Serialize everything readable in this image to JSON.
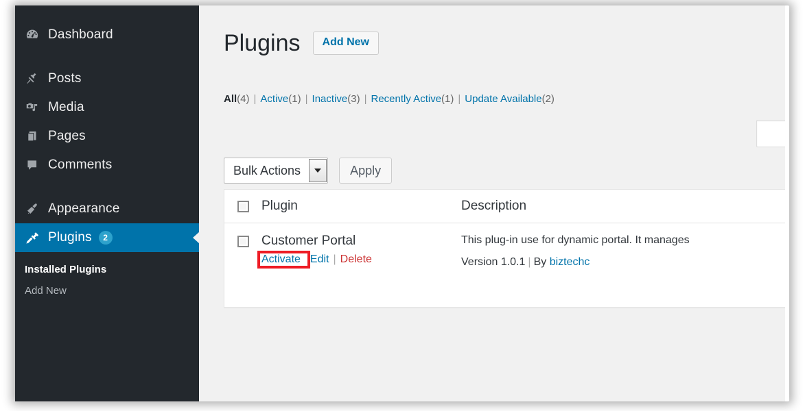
{
  "sidebar": {
    "items": [
      {
        "label": "Dashboard",
        "icon": "dashboard-gauge-icon",
        "name": "dashboard"
      },
      {
        "label": "Posts",
        "icon": "pushpin-icon",
        "name": "posts"
      },
      {
        "label": "Media",
        "icon": "media-camera-music-icon",
        "name": "media"
      },
      {
        "label": "Pages",
        "icon": "pages-stack-icon",
        "name": "pages"
      },
      {
        "label": "Comments",
        "icon": "comment-bubble-icon",
        "name": "comments"
      },
      {
        "label": "Appearance",
        "icon": "paintbrush-icon",
        "name": "appearance"
      },
      {
        "label": "Plugins",
        "icon": "plug-icon",
        "name": "plugins",
        "badge": "2",
        "current": true
      }
    ],
    "submenu": [
      {
        "label": "Installed Plugins",
        "current": true
      },
      {
        "label": "Add New",
        "current": false
      }
    ]
  },
  "header": {
    "title": "Plugins",
    "add_new_label": "Add New"
  },
  "filters": {
    "items": [
      {
        "label": "All",
        "count": "(4)",
        "current": true
      },
      {
        "label": "Active",
        "count": "(1)",
        "current": false
      },
      {
        "label": "Inactive",
        "count": "(3)",
        "current": false
      },
      {
        "label": "Recently Active",
        "count": "(1)",
        "current": false
      },
      {
        "label": "Update Available",
        "count": "(2)",
        "current": false
      }
    ],
    "separator": "|"
  },
  "search": {
    "value": "",
    "placeholder": ""
  },
  "tablenav": {
    "bulk_actions_label": "Bulk Actions",
    "apply_label": "Apply"
  },
  "table": {
    "headers": {
      "plugin": "Plugin",
      "description": "Description"
    },
    "rows": [
      {
        "name": "Customer Portal",
        "actions": {
          "activate": "Activate",
          "edit": "Edit",
          "delete": "Delete",
          "separator": "|"
        },
        "description": "This plug-in use for dynamic portal. It manages",
        "version_label": "Version 1.0.1",
        "by_label": "By",
        "author": "biztechc",
        "meta_separator": "|"
      }
    ]
  },
  "highlight": {
    "target": "Activate",
    "color": "#ee1c25"
  },
  "colors": {
    "sidebar_bg": "#23282d",
    "accent_blue": "#0073aa",
    "link_blue": "#0073aa",
    "delete_red": "#cc3333",
    "content_bg": "#f1f1f1",
    "badge_blue": "#2ea2cc"
  }
}
